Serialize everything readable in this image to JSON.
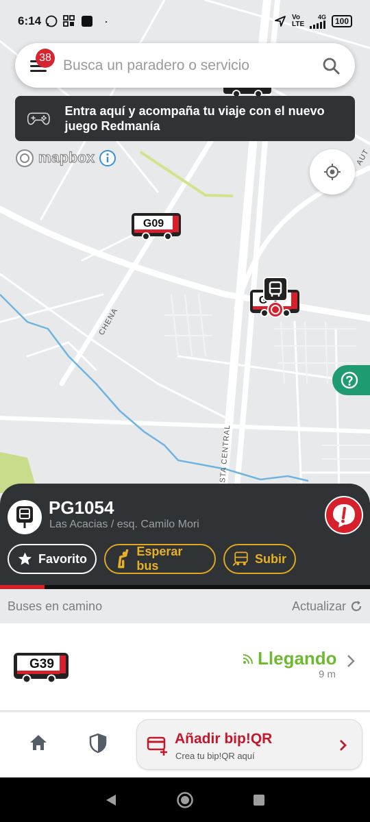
{
  "status_bar": {
    "time": "6:14",
    "network_label": "4G",
    "volte_label": "Vo LTE",
    "battery": "100"
  },
  "search": {
    "placeholder": "Busca un paradero o servicio",
    "notification_count": "38"
  },
  "banner": {
    "text": "Entra aquí y acompaña tu viaje con el nuevo juego Redmanía",
    "icon": "gamepad-icon"
  },
  "map": {
    "attribution": "mapbox",
    "street_labels": [
      "CHENA",
      "STA CENTRAL",
      "AUT"
    ],
    "bus_labels": [
      "G09",
      "G"
    ]
  },
  "stop": {
    "code": "PG1054",
    "address": "Las Acacias / esq. Camilo Mori",
    "actions": {
      "favorite": "Favorito",
      "wait": "Esperar bus",
      "board": "Subir"
    },
    "progress_fraction": 0.12
  },
  "buses_section": {
    "title": "Buses en camino",
    "refresh": "Actualizar"
  },
  "buses": [
    {
      "route": "G39",
      "status": "Llegando",
      "eta": "9 m"
    }
  ],
  "bottom_bar": {
    "bip_title": "Añadir bip!QR",
    "bip_subtitle": "Crea tu bip!QR aquí"
  },
  "colors": {
    "accent_red": "#d6202b",
    "panel_dark": "#2f3336",
    "wait_yellow": "#e8b125",
    "arriving_green": "#6fb832",
    "help_green": "#1f9b72"
  }
}
